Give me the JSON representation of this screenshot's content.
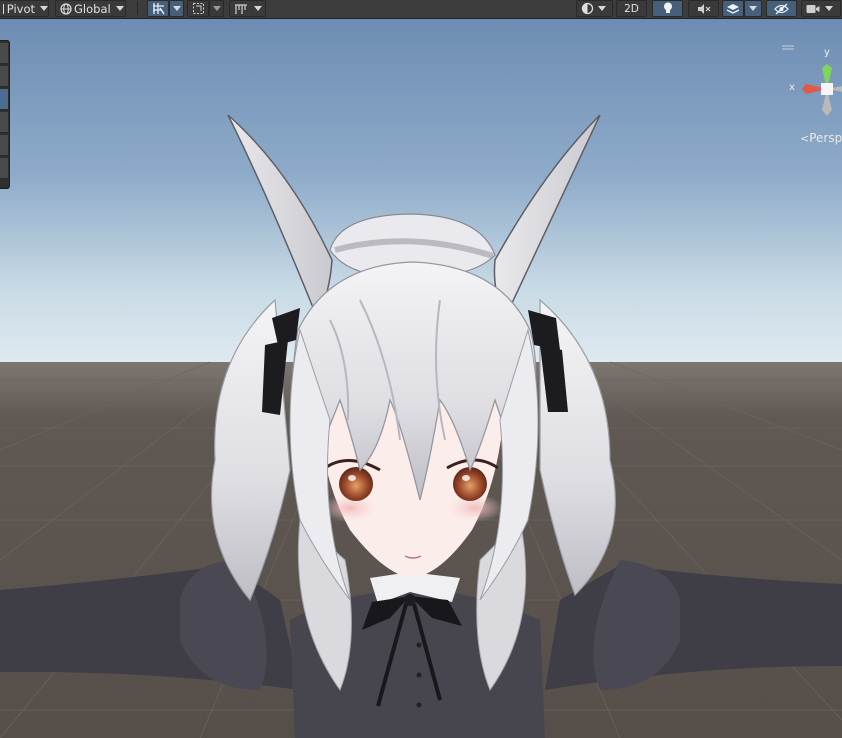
{
  "toolbar": {
    "pivot_label": "Pivot",
    "global_label": "Global",
    "mode_2d_label": "2D"
  },
  "icons": {
    "pivot": "pivot-icon",
    "global": "globe-icon",
    "grid_snap": "grid-snap-icon",
    "snap_increment": "snap-increment-icon",
    "ruler": "ruler-icon",
    "draw_mode": "draw-mode-icon",
    "lighting": "lightbulb-icon",
    "audio": "audio-mute-icon",
    "effects": "effects-icon",
    "visibility": "hidden-eye-icon",
    "camera": "camera-icon"
  },
  "gizmo": {
    "y_label": "y",
    "x_label": "x",
    "projection_label": "Persp"
  },
  "colors": {
    "toolbar_bg": "#3c3c3c",
    "active_button": "#46607c",
    "sky_top": "#6f8fb6",
    "horizon": "#d8e4ea",
    "ground": "#5a534d"
  }
}
